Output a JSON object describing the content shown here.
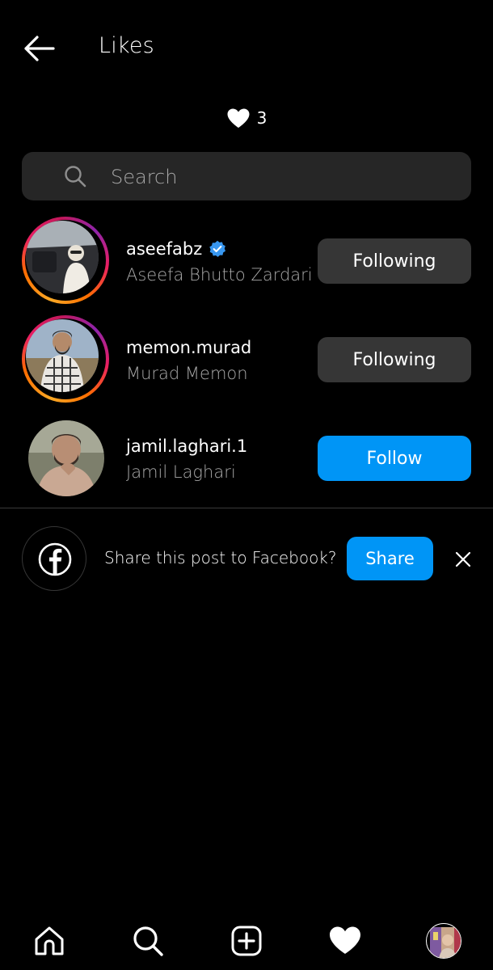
{
  "header": {
    "title": "Likes",
    "back_icon": "arrow-left-icon"
  },
  "likes": {
    "icon": "heart-icon",
    "count": "3"
  },
  "search": {
    "placeholder": "Search",
    "value": "",
    "icon": "search-icon"
  },
  "users": [
    {
      "username": "aseefabz",
      "full_name": "Aseefa Bhutto Zardari",
      "verified": true,
      "has_story_ring": true,
      "button_label": "Following",
      "button_state": "following"
    },
    {
      "username": "memon.murad",
      "full_name": "Murad Memon",
      "verified": false,
      "has_story_ring": true,
      "button_label": "Following",
      "button_state": "following"
    },
    {
      "username": "jamil.laghari.1",
      "full_name": "Jamil Laghari",
      "verified": false,
      "has_story_ring": false,
      "button_label": "Follow",
      "button_state": "follow"
    }
  ],
  "facebook_share": {
    "icon": "facebook-icon",
    "prompt": "Share this post to Facebook?",
    "share_label": "Share",
    "close_icon": "close-icon"
  },
  "bottom_nav": [
    {
      "id": "home",
      "icon": "home-icon"
    },
    {
      "id": "search",
      "icon": "search-icon"
    },
    {
      "id": "create",
      "icon": "add-post-icon"
    },
    {
      "id": "activity",
      "icon": "heart-icon"
    },
    {
      "id": "profile",
      "icon": "profile-avatar"
    }
  ],
  "colors": {
    "background": "#000000",
    "surface": "#262626",
    "button_following": "#363636",
    "accent_blue": "#0095f6",
    "verified_blue": "#3897f0",
    "secondary_text": "#a8a8a8"
  }
}
